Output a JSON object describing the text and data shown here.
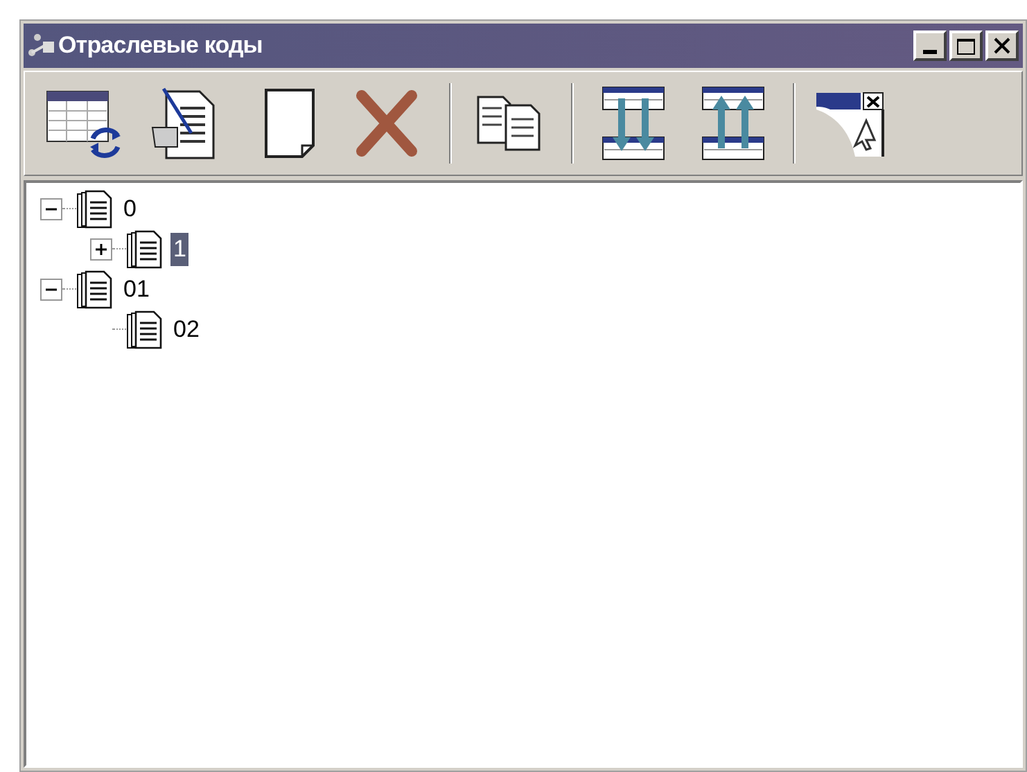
{
  "window": {
    "title": "Отраслевые коды"
  },
  "tree": [
    {
      "label": "0",
      "expanded": true,
      "selected": false,
      "children": [
        {
          "label": "1",
          "expanded": false,
          "selected": true
        }
      ]
    },
    {
      "label": "01",
      "expanded": true,
      "selected": false,
      "children": [
        {
          "label": "02",
          "selected": false
        }
      ]
    }
  ]
}
